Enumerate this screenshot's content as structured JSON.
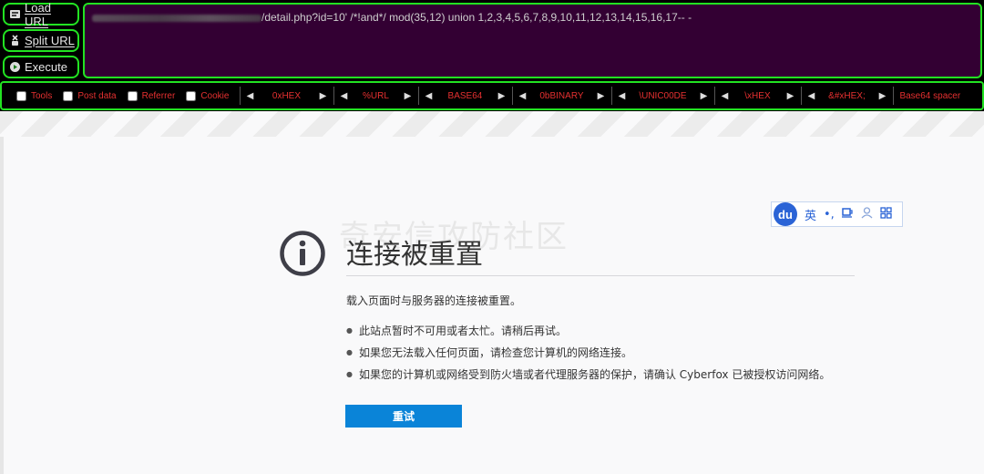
{
  "hackbar": {
    "load_url": "Load URL",
    "split_url": "Split URL",
    "execute": "Execute",
    "url_text": "/detail.php?id=10'  /*!and*/ mod(35,12) union 1,2,3,4,5,6,7,8,9,10,11,12,13,14,15,16,17-- -",
    "options": [
      "Tools",
      "Post data",
      "Referrer",
      "Cookie"
    ],
    "encoders": [
      "0xHEX",
      "%URL",
      "BASE64",
      "0bBINARY",
      "\\UNIC00DE",
      "\\xHEX",
      "&#xHEX;"
    ],
    "base64_spacer": "Base64 spacer",
    "colors": {
      "border": "#22e322",
      "url_bg": "#330033",
      "label_red": "#e53030"
    }
  },
  "ime": {
    "logo": "du",
    "items": [
      "英",
      "•,",
      "☕",
      "👤",
      "▦"
    ]
  },
  "watermark": "奇安信攻防社区",
  "error": {
    "title": "连接被重置",
    "description": "载入页面时与服务器的连接被重置。",
    "bullets": [
      "此站点暂时不可用或者太忙。请稍后再试。",
      "如果您无法载入任何页面，请检查您计算机的网络连接。",
      "如果您的计算机或网络受到防火墙或者代理服务器的保护，请确认 Cyberfox 已被授权访问网络。"
    ],
    "retry_button": "重试"
  }
}
